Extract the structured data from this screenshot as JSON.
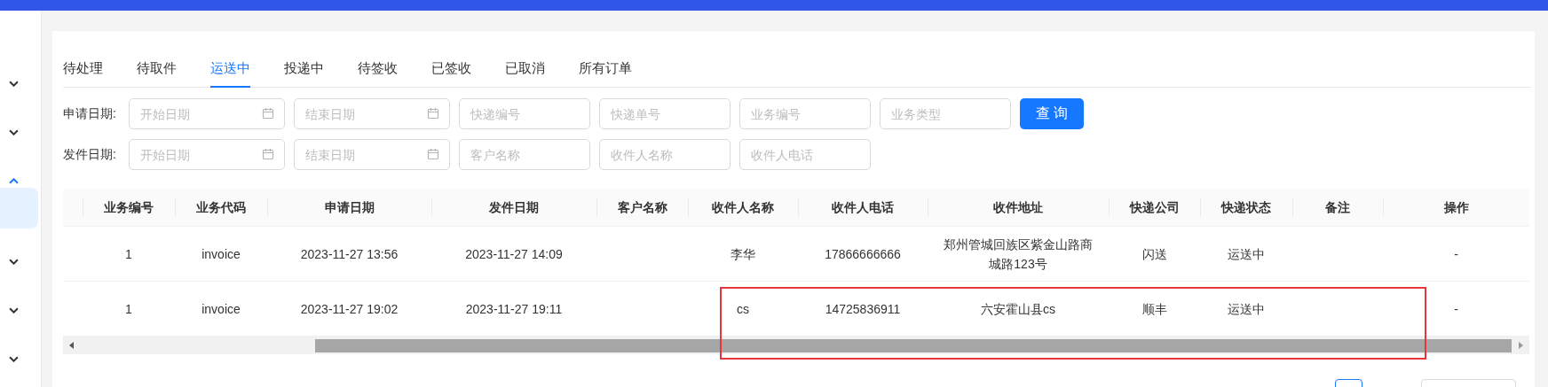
{
  "sidebar": {
    "items": [
      {
        "expanded": false
      },
      {
        "expanded": false
      },
      {
        "expanded": true
      },
      {
        "kind": "child",
        "selected": true
      },
      {
        "expanded": false
      },
      {
        "expanded": false
      },
      {
        "expanded": false
      }
    ]
  },
  "tabs": [
    {
      "label": "待处理",
      "selected": false
    },
    {
      "label": "待取件",
      "selected": false
    },
    {
      "label": "运送中",
      "selected": true
    },
    {
      "label": "投递中",
      "selected": false
    },
    {
      "label": "待签收",
      "selected": false
    },
    {
      "label": "已签收",
      "selected": false
    },
    {
      "label": "已取消",
      "selected": false
    },
    {
      "label": "所有订单",
      "selected": false
    }
  ],
  "filters": [
    {
      "label": "申请日期:",
      "fields": [
        {
          "kind": "date",
          "placeholder": "开始日期"
        },
        {
          "kind": "date",
          "placeholder": "结束日期"
        },
        {
          "kind": "text",
          "placeholder": "快递编号"
        },
        {
          "kind": "text",
          "placeholder": "快递单号"
        },
        {
          "kind": "text",
          "placeholder": "业务编号"
        },
        {
          "kind": "text",
          "placeholder": "业务类型"
        }
      ],
      "button": "查 询"
    },
    {
      "label": "发件日期:",
      "fields": [
        {
          "kind": "date",
          "placeholder": "开始日期"
        },
        {
          "kind": "date",
          "placeholder": "结束日期"
        },
        {
          "kind": "text",
          "placeholder": "客户名称"
        },
        {
          "kind": "text",
          "placeholder": "收件人名称"
        },
        {
          "kind": "text",
          "placeholder": "收件人电话"
        }
      ]
    }
  ],
  "table": {
    "columns": [
      "业务编号",
      "业务代码",
      "申请日期",
      "发件日期",
      "客户名称",
      "收件人名称",
      "收件人电话",
      "收件地址",
      "快递公司",
      "快递状态",
      "备注",
      "操作"
    ],
    "rows": [
      [
        "1",
        "invoice",
        "2023-11-27 13:56",
        "2023-11-27 14:09",
        "",
        "李华",
        "17866666666",
        "郑州管城回族区紫金山路商城路123号",
        "闪送",
        "运送中",
        "",
        "-"
      ],
      [
        "1",
        "invoice",
        "2023-11-27 19:02",
        "2023-11-27 19:11",
        "",
        "cs",
        "14725836911",
        "六安霍山县cs",
        "顺丰",
        "运送中",
        "",
        "-"
      ]
    ],
    "highlight_box": true
  },
  "pagination": {
    "kind": "pager"
  }
}
